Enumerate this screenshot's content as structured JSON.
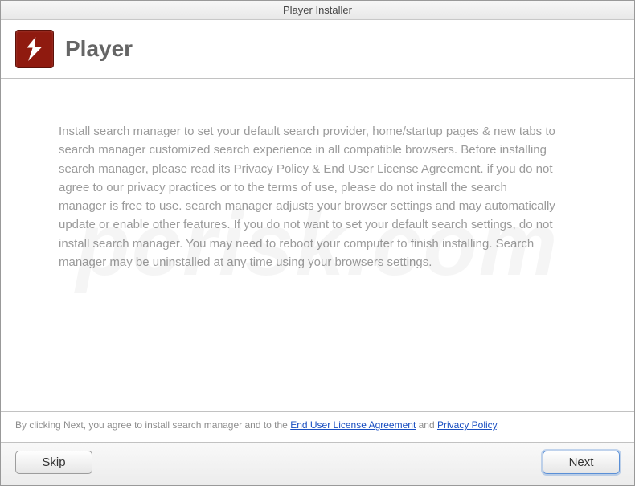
{
  "window": {
    "title": "Player Installer"
  },
  "header": {
    "app_name": "Player"
  },
  "body": {
    "text": "Install search manager to set your default search provider, home/startup pages & new tabs to search manager customized search experience in all compatible browsers. Before installing search manager, please read its Privacy Policy & End User License Agreement. if you do not agree to our privacy practices or to the terms of use, please do not install the search manager is free to use. search manager adjusts your browser settings and may automatically update or enable other features. If you do not want to set your default search settings, do not install search manager. You may need to reboot your computer to finish installing. Search manager may be uninstalled at any time using your browsers settings."
  },
  "legal": {
    "prefix": "By clicking Next, you agree to install search manager and to the ",
    "eula": "End User License Agreement",
    "and": " and ",
    "privacy": "Privacy Policy",
    "suffix": "."
  },
  "buttons": {
    "skip": "Skip",
    "next": "Next"
  },
  "watermark": "pcrisk.com"
}
